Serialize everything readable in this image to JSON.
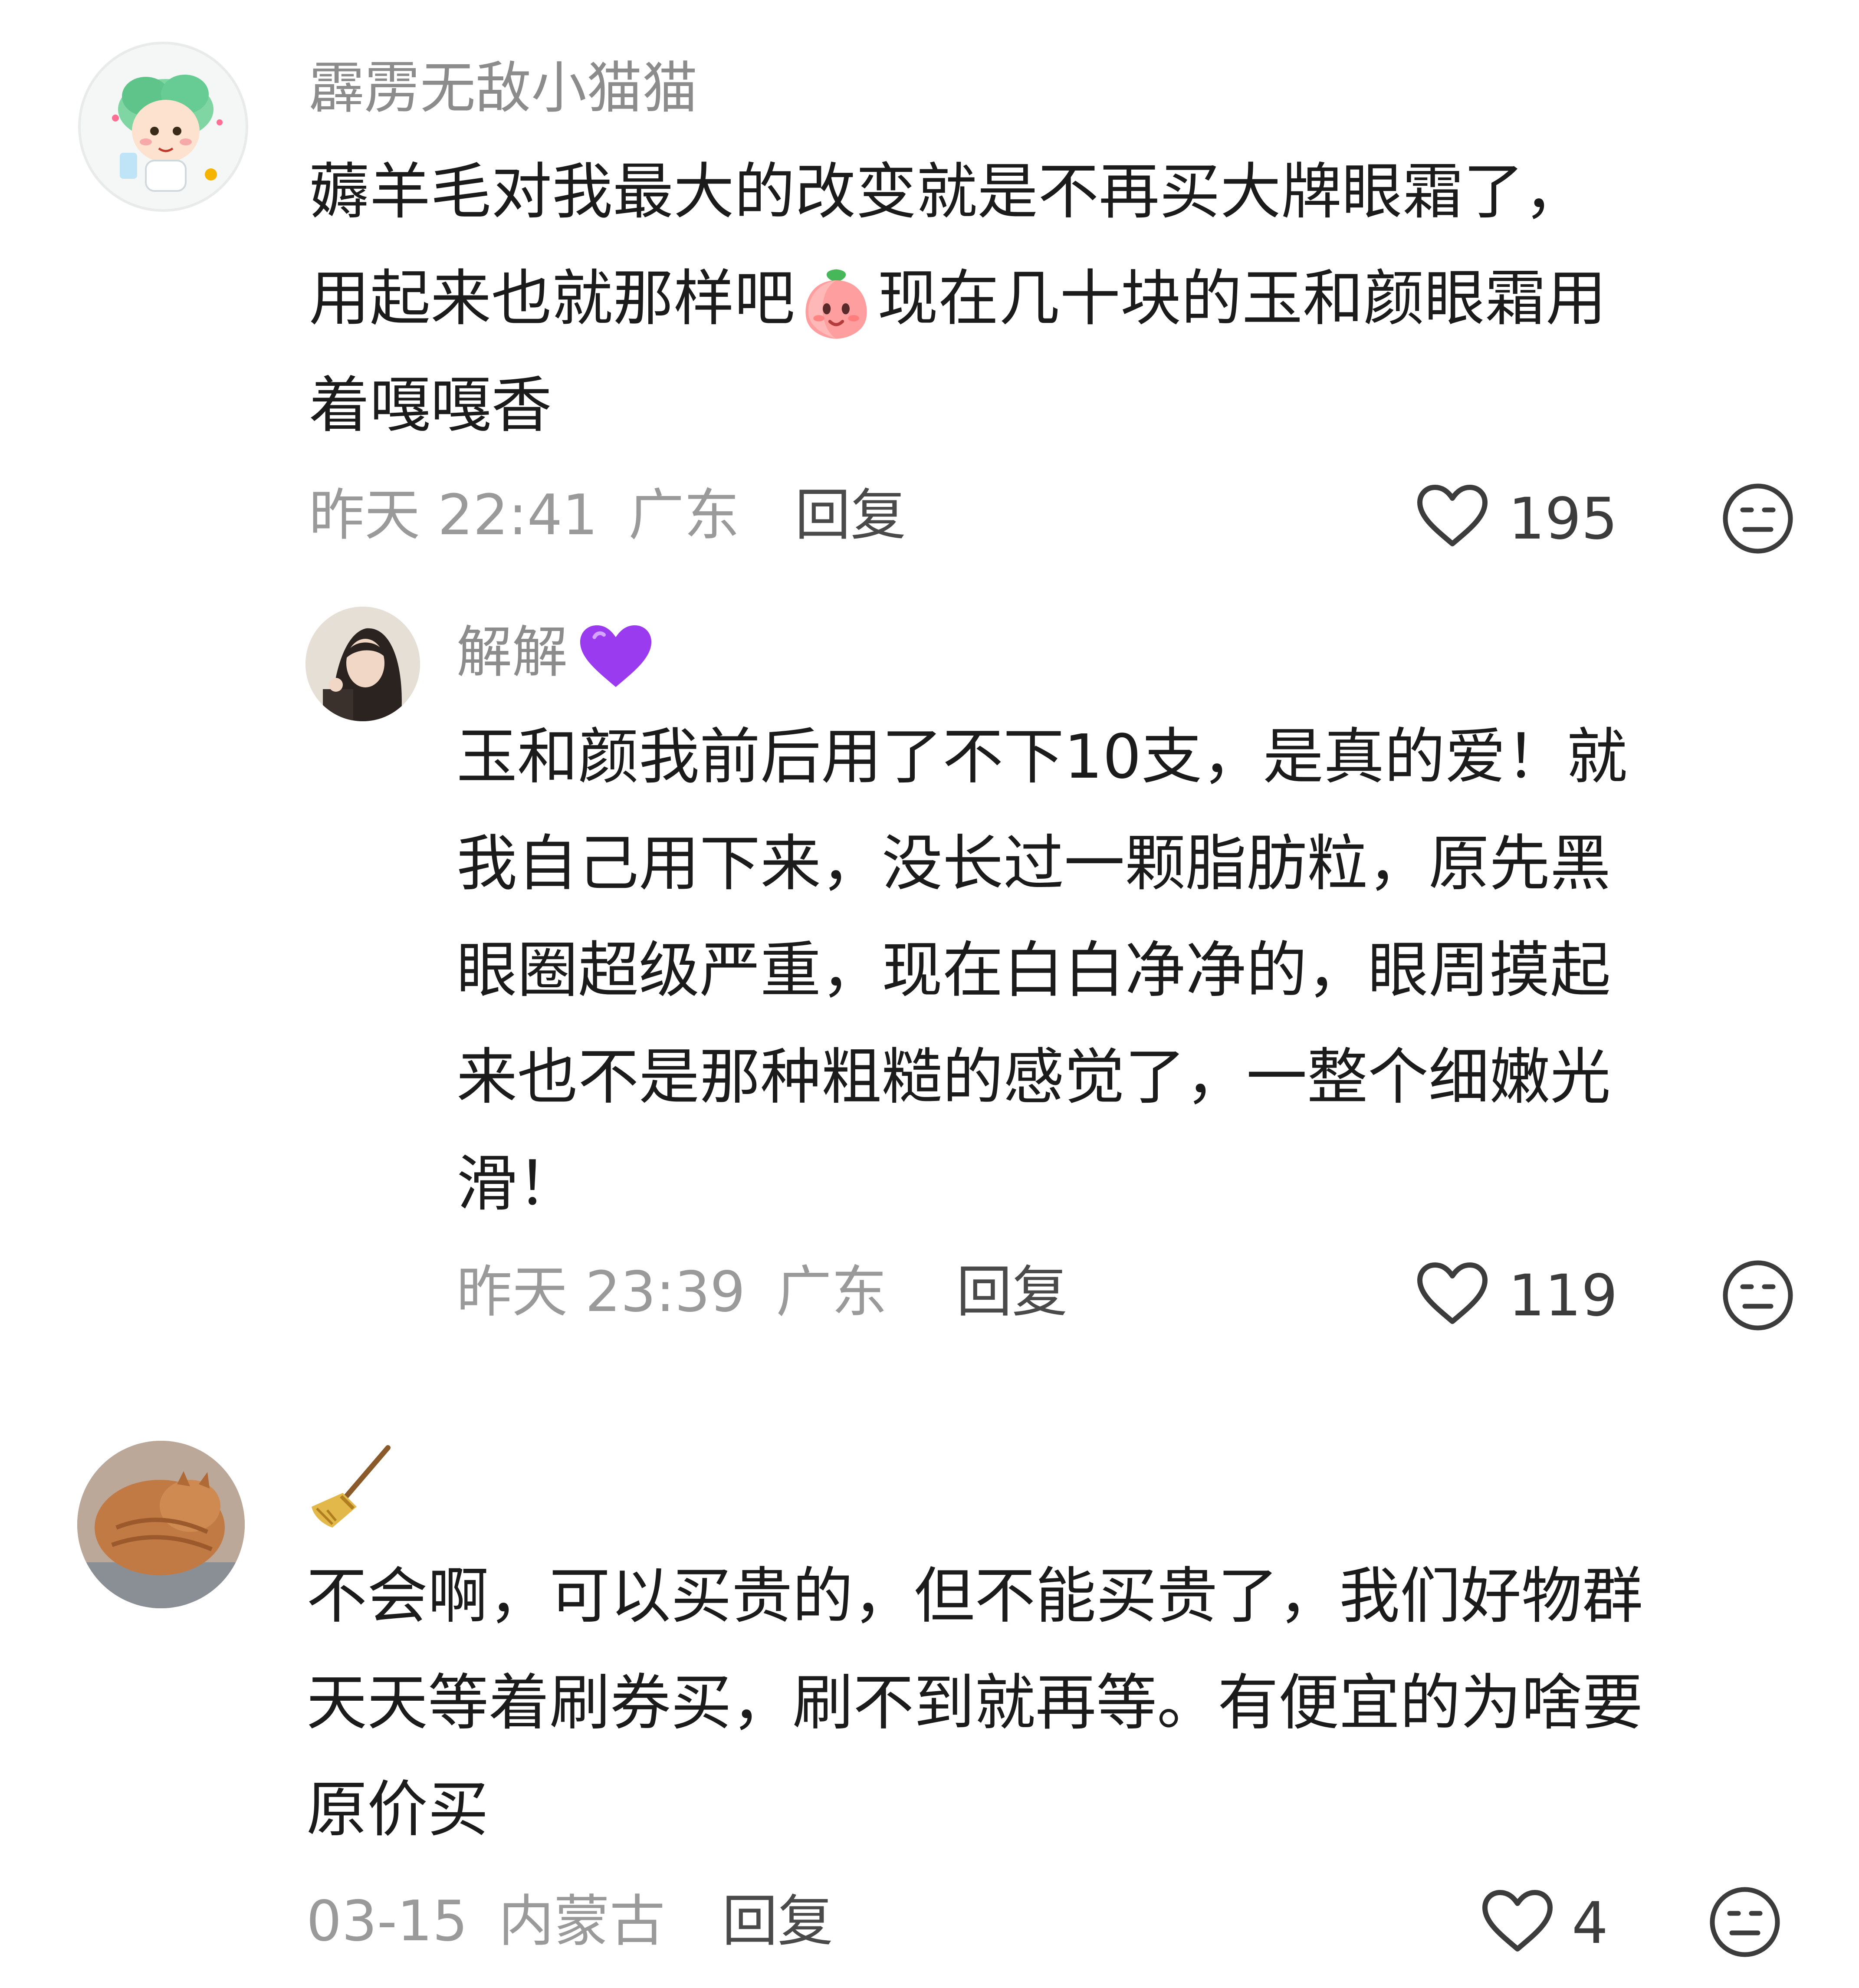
{
  "comments": [
    {
      "username": "霹雳无敌小猫猫",
      "lines": [
        "薅羊毛对我最大的改变就是不再买大牌眼霜了，",
        "用起来也就那样吧",
        "现在几十块的玉和颜眼霜用",
        "着嘎嘎香"
      ],
      "inline_emoji": "peach-face-emoji",
      "time": "昨天 22:41",
      "location": "广东",
      "reply_label": "回复",
      "likes": "195"
    },
    {
      "username": "解解",
      "username_emoji": "purple-heart",
      "lines": [
        "玉和颜我前后用了不下10支，是真的爱！就",
        "我自己用下来，没长过一颗脂肪粒，原先黑",
        "眼圈超级严重，现在白白净净的，眼周摸起",
        "来也不是那种粗糙的感觉了，一整个细嫩光",
        "滑！"
      ],
      "time": "昨天 23:39",
      "location": "广东",
      "reply_label": "回复",
      "likes": "119"
    },
    {
      "username_emoji": "broom",
      "lines": [
        "不会啊，可以买贵的，但不能买贵了，我们好物群",
        "天天等着刷券买，刷不到就再等。有便宜的为啥要",
        "原价买"
      ],
      "time": "03-15",
      "location": "内蒙古",
      "reply_label": "回复",
      "likes": "4"
    }
  ],
  "colors": {
    "username": "#8c8c8c",
    "text": "#1b1b1b",
    "meta": "#9a9a9a",
    "icon": "#3c3c3c",
    "heart_emoji": "#9b3bf0"
  }
}
